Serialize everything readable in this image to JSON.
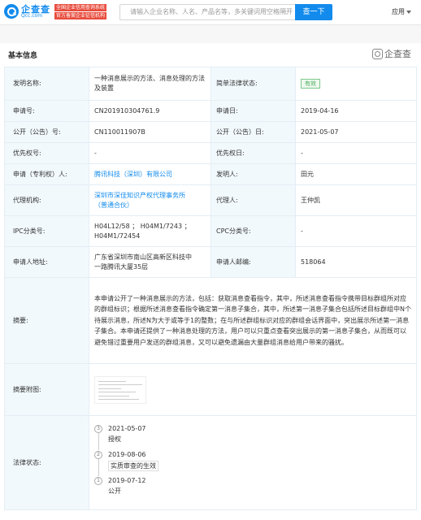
{
  "header": {
    "logo_name": "企查查",
    "logo_domain": "Qcc.com",
    "slogan_line1": "全国企业信用查询系统",
    "slogan_line2": "官方备案企业征信机构",
    "search_placeholder": "请输入企业名称、人名、产品名等，多关键词用空格隔开",
    "search_button": "查一下",
    "app_menu": "应用"
  },
  "section": {
    "title": "基本信息",
    "watermark": "企查查"
  },
  "rows": {
    "invention_name": {
      "label": "发明名称:",
      "value": "一种消息展示的方法、消息处理的方法及装置"
    },
    "legal_status_simple": {
      "label": "简单法律状态:",
      "value": "有效"
    },
    "app_no": {
      "label": "申请号:",
      "value": "CN201910304761.9"
    },
    "app_date": {
      "label": "申请日:",
      "value": "2019-04-16"
    },
    "pub_no": {
      "label": "公开（公告）号:",
      "value": "CN110011907B"
    },
    "pub_date": {
      "label": "公开（公告）日:",
      "value": "2021-05-07"
    },
    "priority_no": {
      "label": "优先权号:",
      "value": "-"
    },
    "priority_date": {
      "label": "优先权日:",
      "value": "-"
    },
    "applicant": {
      "label": "申请（专利权）人:",
      "value": "腾讯科技（深圳）有限公司"
    },
    "inventor": {
      "label": "发明人:",
      "value": "田元"
    },
    "agency": {
      "label": "代理机构:",
      "value_line1": "深圳市深佳知识产权代理事务所",
      "value_line2": "（普通合伙）"
    },
    "agent": {
      "label": "代理人:",
      "value": "王仲凯"
    },
    "ipc": {
      "label": "IPC分类号:",
      "value_line1": "H04L12/58 ； H04M1/7243 ；",
      "value_line2": "H04M1/72454"
    },
    "cpc": {
      "label": "CPC分类号:",
      "value": "-"
    },
    "address": {
      "label": "申请人地址:",
      "value_line1": "广东省深圳市南山区高新区科技中",
      "value_line2": "一路腾讯大厦35层"
    },
    "postcode": {
      "label": "申请人邮编:",
      "value": "518064"
    },
    "abstract": {
      "label": "摘要:",
      "value": "本申请公开了一种消息展示的方法，包括：获取消息查看指令，其中，所述消息查看指令携带目标群组所对应的群组标识；根据所述消息查看指令确定第一消息子集合，其中，所述第一消息子集合包括所述目标群组中N个待展示消息，所述N为大于或等于1的整数；在与所述群组标识对应的群组会话界面中，突出展示所述第一消息子集合。本申请还提供了一种消息处理的方法，用户可以只重点查看突出展示的第一消息子集合，从而既可以避免错过重要用户发送的群组消息，又可以避免遗漏由大量群组消息给用户带来的骚扰。"
    },
    "abstract_figure": {
      "label": "摘要附图:"
    },
    "legal_status": {
      "label": "法律状态:",
      "events": [
        {
          "step": "3",
          "date": "2021-05-07",
          "desc": "授权"
        },
        {
          "step": "2",
          "date": "2019-08-06",
          "desc": "实质审查的生效"
        },
        {
          "step": "1",
          "date": "2019-07-12",
          "desc": "公开"
        }
      ]
    }
  },
  "colors": {
    "brand": "#128bed",
    "label_bg": "#f2f9fc",
    "status_green": "#4cae5c"
  }
}
